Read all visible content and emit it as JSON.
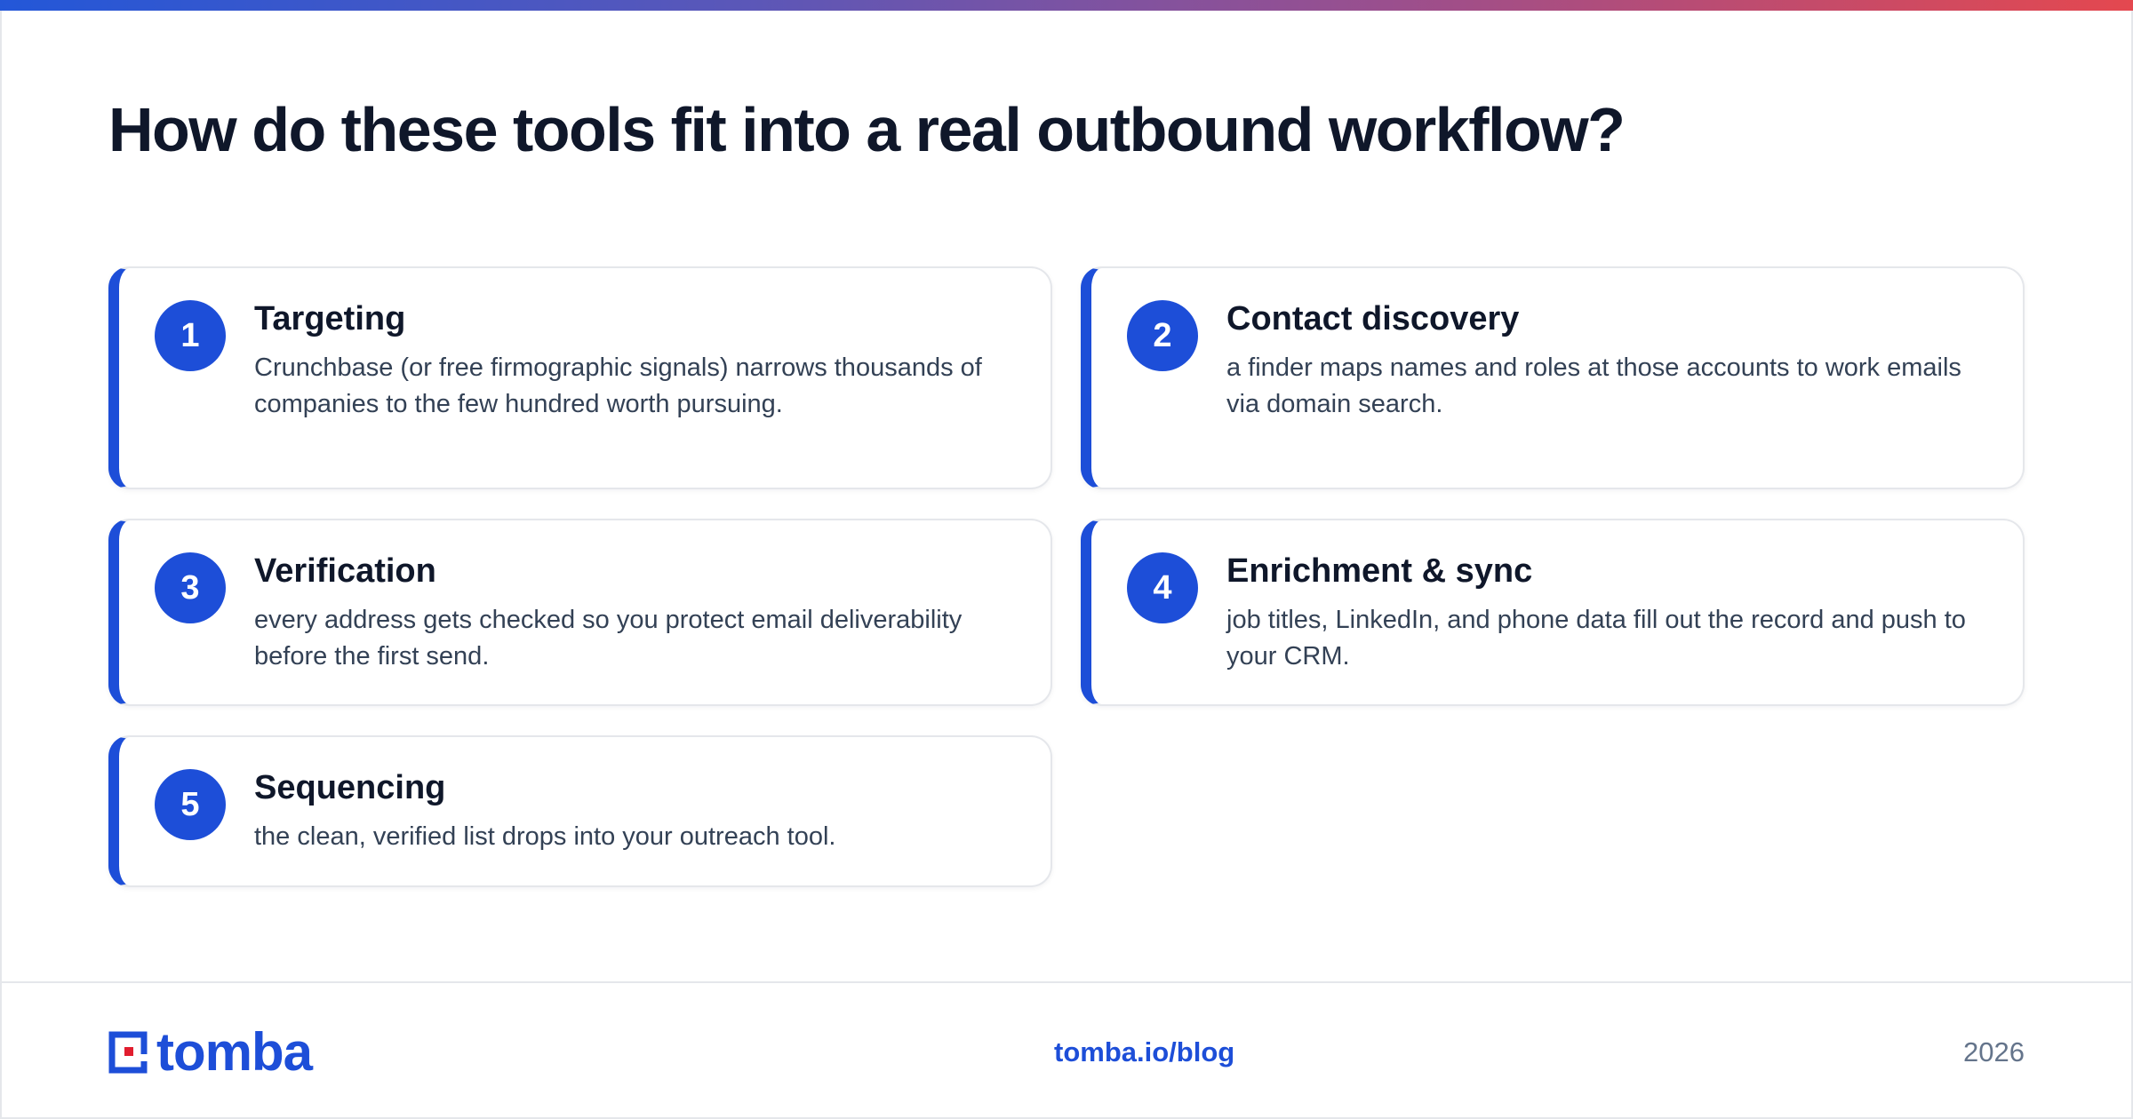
{
  "heading": "How do these tools fit into a real outbound workflow?",
  "colors": {
    "accent": "#1d4ed8",
    "text": "#0f172a",
    "muted": "#334155",
    "gradient_start": "#2357d8",
    "gradient_end": "#e4484f",
    "logo_red": "#e11d2e"
  },
  "steps": [
    {
      "number": "1",
      "title": "Targeting",
      "description": "Crunchbase (or free firmographic signals) narrows thousands of companies to the few hundred worth pursuing."
    },
    {
      "number": "2",
      "title": "Contact discovery",
      "description": "a finder maps names and roles at those accounts to work emails via domain search."
    },
    {
      "number": "3",
      "title": "Verification",
      "description": "every address gets checked so you protect email deliverability before the first send."
    },
    {
      "number": "4",
      "title": "Enrichment & sync",
      "description": "job titles, LinkedIn, and phone data fill out the record and push to your CRM."
    },
    {
      "number": "5",
      "title": "Sequencing",
      "description": "the clean, verified list drops into your outreach tool."
    }
  ],
  "footer": {
    "logo_text": "tomba",
    "link": "tomba.io/blog",
    "year": "2026"
  }
}
